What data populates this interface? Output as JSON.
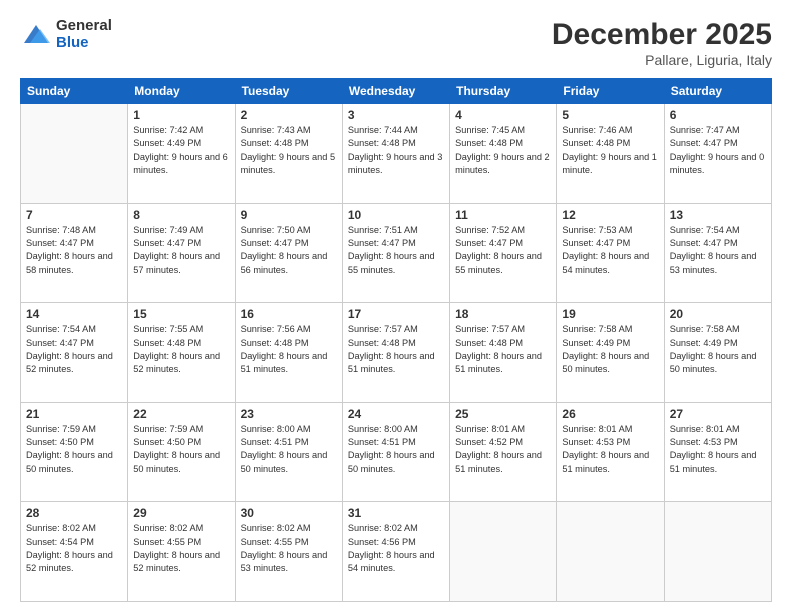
{
  "logo": {
    "general": "General",
    "blue": "Blue"
  },
  "header": {
    "month": "December 2025",
    "location": "Pallare, Liguria, Italy"
  },
  "days_of_week": [
    "Sunday",
    "Monday",
    "Tuesday",
    "Wednesday",
    "Thursday",
    "Friday",
    "Saturday"
  ],
  "weeks": [
    [
      {
        "day": "",
        "sunrise": "",
        "sunset": "",
        "daylight": ""
      },
      {
        "day": "1",
        "sunrise": "Sunrise: 7:42 AM",
        "sunset": "Sunset: 4:49 PM",
        "daylight": "Daylight: 9 hours and 6 minutes."
      },
      {
        "day": "2",
        "sunrise": "Sunrise: 7:43 AM",
        "sunset": "Sunset: 4:48 PM",
        "daylight": "Daylight: 9 hours and 5 minutes."
      },
      {
        "day": "3",
        "sunrise": "Sunrise: 7:44 AM",
        "sunset": "Sunset: 4:48 PM",
        "daylight": "Daylight: 9 hours and 3 minutes."
      },
      {
        "day": "4",
        "sunrise": "Sunrise: 7:45 AM",
        "sunset": "Sunset: 4:48 PM",
        "daylight": "Daylight: 9 hours and 2 minutes."
      },
      {
        "day": "5",
        "sunrise": "Sunrise: 7:46 AM",
        "sunset": "Sunset: 4:48 PM",
        "daylight": "Daylight: 9 hours and 1 minute."
      },
      {
        "day": "6",
        "sunrise": "Sunrise: 7:47 AM",
        "sunset": "Sunset: 4:47 PM",
        "daylight": "Daylight: 9 hours and 0 minutes."
      }
    ],
    [
      {
        "day": "7",
        "sunrise": "Sunrise: 7:48 AM",
        "sunset": "Sunset: 4:47 PM",
        "daylight": "Daylight: 8 hours and 58 minutes."
      },
      {
        "day": "8",
        "sunrise": "Sunrise: 7:49 AM",
        "sunset": "Sunset: 4:47 PM",
        "daylight": "Daylight: 8 hours and 57 minutes."
      },
      {
        "day": "9",
        "sunrise": "Sunrise: 7:50 AM",
        "sunset": "Sunset: 4:47 PM",
        "daylight": "Daylight: 8 hours and 56 minutes."
      },
      {
        "day": "10",
        "sunrise": "Sunrise: 7:51 AM",
        "sunset": "Sunset: 4:47 PM",
        "daylight": "Daylight: 8 hours and 55 minutes."
      },
      {
        "day": "11",
        "sunrise": "Sunrise: 7:52 AM",
        "sunset": "Sunset: 4:47 PM",
        "daylight": "Daylight: 8 hours and 55 minutes."
      },
      {
        "day": "12",
        "sunrise": "Sunrise: 7:53 AM",
        "sunset": "Sunset: 4:47 PM",
        "daylight": "Daylight: 8 hours and 54 minutes."
      },
      {
        "day": "13",
        "sunrise": "Sunrise: 7:54 AM",
        "sunset": "Sunset: 4:47 PM",
        "daylight": "Daylight: 8 hours and 53 minutes."
      }
    ],
    [
      {
        "day": "14",
        "sunrise": "Sunrise: 7:54 AM",
        "sunset": "Sunset: 4:47 PM",
        "daylight": "Daylight: 8 hours and 52 minutes."
      },
      {
        "day": "15",
        "sunrise": "Sunrise: 7:55 AM",
        "sunset": "Sunset: 4:48 PM",
        "daylight": "Daylight: 8 hours and 52 minutes."
      },
      {
        "day": "16",
        "sunrise": "Sunrise: 7:56 AM",
        "sunset": "Sunset: 4:48 PM",
        "daylight": "Daylight: 8 hours and 51 minutes."
      },
      {
        "day": "17",
        "sunrise": "Sunrise: 7:57 AM",
        "sunset": "Sunset: 4:48 PM",
        "daylight": "Daylight: 8 hours and 51 minutes."
      },
      {
        "day": "18",
        "sunrise": "Sunrise: 7:57 AM",
        "sunset": "Sunset: 4:48 PM",
        "daylight": "Daylight: 8 hours and 51 minutes."
      },
      {
        "day": "19",
        "sunrise": "Sunrise: 7:58 AM",
        "sunset": "Sunset: 4:49 PM",
        "daylight": "Daylight: 8 hours and 50 minutes."
      },
      {
        "day": "20",
        "sunrise": "Sunrise: 7:58 AM",
        "sunset": "Sunset: 4:49 PM",
        "daylight": "Daylight: 8 hours and 50 minutes."
      }
    ],
    [
      {
        "day": "21",
        "sunrise": "Sunrise: 7:59 AM",
        "sunset": "Sunset: 4:50 PM",
        "daylight": "Daylight: 8 hours and 50 minutes."
      },
      {
        "day": "22",
        "sunrise": "Sunrise: 7:59 AM",
        "sunset": "Sunset: 4:50 PM",
        "daylight": "Daylight: 8 hours and 50 minutes."
      },
      {
        "day": "23",
        "sunrise": "Sunrise: 8:00 AM",
        "sunset": "Sunset: 4:51 PM",
        "daylight": "Daylight: 8 hours and 50 minutes."
      },
      {
        "day": "24",
        "sunrise": "Sunrise: 8:00 AM",
        "sunset": "Sunset: 4:51 PM",
        "daylight": "Daylight: 8 hours and 50 minutes."
      },
      {
        "day": "25",
        "sunrise": "Sunrise: 8:01 AM",
        "sunset": "Sunset: 4:52 PM",
        "daylight": "Daylight: 8 hours and 51 minutes."
      },
      {
        "day": "26",
        "sunrise": "Sunrise: 8:01 AM",
        "sunset": "Sunset: 4:53 PM",
        "daylight": "Daylight: 8 hours and 51 minutes."
      },
      {
        "day": "27",
        "sunrise": "Sunrise: 8:01 AM",
        "sunset": "Sunset: 4:53 PM",
        "daylight": "Daylight: 8 hours and 51 minutes."
      }
    ],
    [
      {
        "day": "28",
        "sunrise": "Sunrise: 8:02 AM",
        "sunset": "Sunset: 4:54 PM",
        "daylight": "Daylight: 8 hours and 52 minutes."
      },
      {
        "day": "29",
        "sunrise": "Sunrise: 8:02 AM",
        "sunset": "Sunset: 4:55 PM",
        "daylight": "Daylight: 8 hours and 52 minutes."
      },
      {
        "day": "30",
        "sunrise": "Sunrise: 8:02 AM",
        "sunset": "Sunset: 4:55 PM",
        "daylight": "Daylight: 8 hours and 53 minutes."
      },
      {
        "day": "31",
        "sunrise": "Sunrise: 8:02 AM",
        "sunset": "Sunset: 4:56 PM",
        "daylight": "Daylight: 8 hours and 54 minutes."
      },
      {
        "day": "",
        "sunrise": "",
        "sunset": "",
        "daylight": ""
      },
      {
        "day": "",
        "sunrise": "",
        "sunset": "",
        "daylight": ""
      },
      {
        "day": "",
        "sunrise": "",
        "sunset": "",
        "daylight": ""
      }
    ]
  ]
}
